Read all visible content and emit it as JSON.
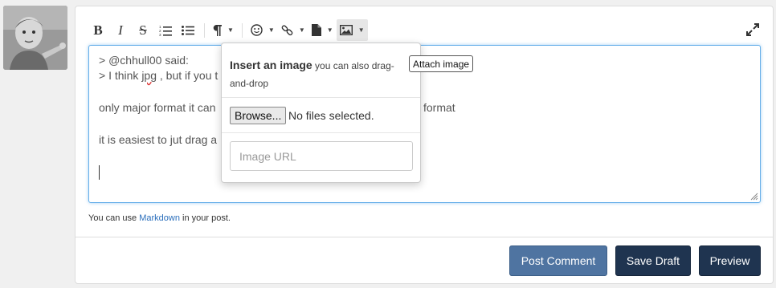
{
  "avatar": {
    "alt": "user avatar"
  },
  "toolbar": {
    "bold": "B",
    "italic": "I",
    "strike": "S",
    "ordered_list_icon": "ordered-list-icon",
    "bullet_list_icon": "bullet-list-icon",
    "paragraph_icon": "paragraph-icon",
    "emoji_icon": "emoji-icon",
    "link_icon": "link-icon",
    "file_icon": "file-icon",
    "image_icon": "image-icon",
    "expand_icon": "expand-icon"
  },
  "editor": {
    "lines": [
      "> @chhull00 said:",
      "> I think ",
      "jpg",
      " , but if you t",
      "only major format it can",
      "format",
      "it is easiest to jut drag a"
    ]
  },
  "hint": {
    "prefix": "You can use ",
    "link": "Markdown",
    "suffix": " in your post."
  },
  "buttons": {
    "post": "Post Comment",
    "draft": "Save Draft",
    "preview": "Preview"
  },
  "image_popover": {
    "title": "Insert an image",
    "subtitle": " you can also drag-and-drop",
    "browse": "Browse...",
    "no_file": "No files selected.",
    "url_placeholder": "Image URL"
  },
  "tooltip": {
    "text": "Attach image"
  },
  "colors": {
    "focus_border": "#66afe9",
    "post_button": "#4f74a1",
    "dark_button": "#1f3450",
    "link": "#2a6ebb"
  }
}
